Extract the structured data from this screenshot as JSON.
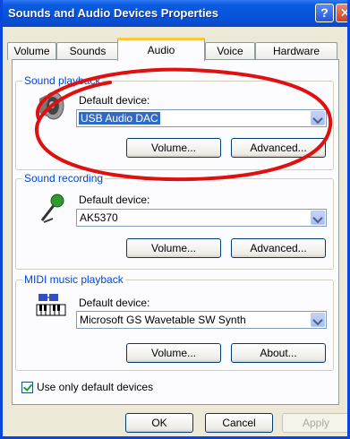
{
  "window": {
    "title": "Sounds and Audio Devices Properties",
    "help_glyph": "?",
    "close_glyph": "✕"
  },
  "tabs": [
    "Volume",
    "Sounds",
    "Audio",
    "Voice",
    "Hardware"
  ],
  "playback": {
    "legend": "Sound playback",
    "default_label": "Default device:",
    "device": "USB Audio DAC",
    "volume_button": "Volume...",
    "advanced_button": "Advanced..."
  },
  "recording": {
    "legend": "Sound recording",
    "default_label": "Default device:",
    "device": "AK5370",
    "volume_button": "Volume...",
    "advanced_button": "Advanced..."
  },
  "midi": {
    "legend": "MIDI music playback",
    "default_label": "Default device:",
    "device": "Microsoft GS Wavetable SW Synth",
    "volume_button": "Volume...",
    "about_button": "About..."
  },
  "options": {
    "use_default_only": "Use only default devices",
    "use_default_only_checked": true
  },
  "footer": {
    "ok": "OK",
    "cancel": "Cancel",
    "apply": "Apply"
  },
  "colors": {
    "accent": "#0046d5",
    "highlight_circle": "#e01010",
    "title_bar": "#0554de"
  }
}
